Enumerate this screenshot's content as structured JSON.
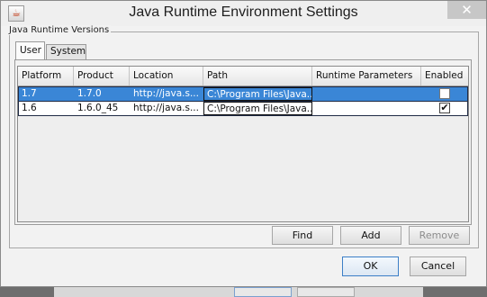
{
  "window": {
    "title": "Java Runtime Environment Settings",
    "icon": "java-cup-icon",
    "close_label": "✕"
  },
  "group": {
    "label": "Java Runtime Versions"
  },
  "tabs": [
    {
      "label": "User",
      "active": true
    },
    {
      "label": "System",
      "active": false
    }
  ],
  "table": {
    "columns": [
      "Platform",
      "Product",
      "Location",
      "Path",
      "Runtime Parameters",
      "Enabled"
    ],
    "rows": [
      {
        "platform": "1.7",
        "product": "1.7.0",
        "location": "http://java.s...",
        "path": "C:\\Program Files\\Java...",
        "runtime_parameters": "",
        "enabled": false,
        "selected": true
      },
      {
        "platform": "1.6",
        "product": "1.6.0_45",
        "location": "http://java.s...",
        "path": "C:\\Program Files\\Java...",
        "runtime_parameters": "",
        "enabled": true,
        "selected": false
      }
    ]
  },
  "buttons": {
    "find": "Find",
    "add": "Add",
    "remove": "Remove",
    "ok": "OK",
    "cancel": "Cancel"
  },
  "colors": {
    "selection": "#3a86d6",
    "window_bg": "#f2f2f2",
    "accent_border": "#3c7fc7"
  }
}
